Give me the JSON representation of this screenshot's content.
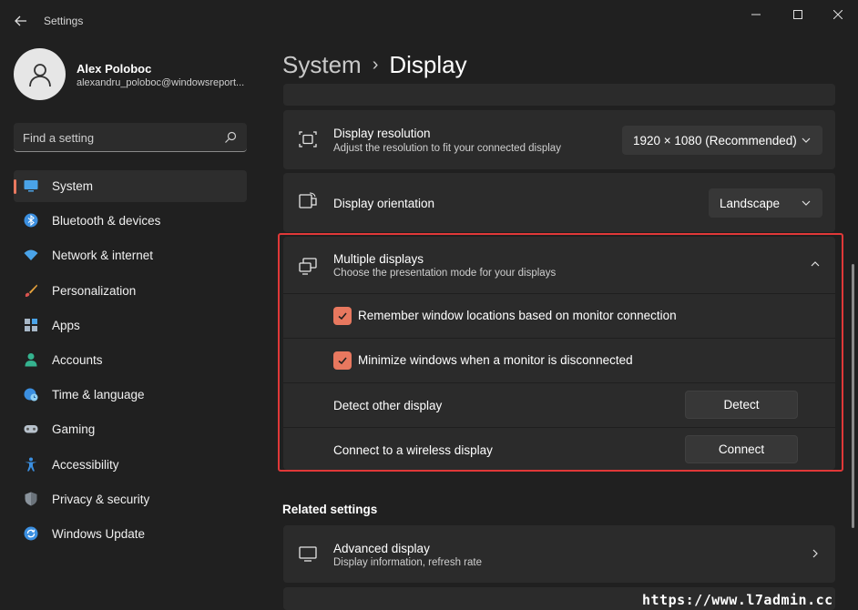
{
  "window": {
    "title": "Settings",
    "accent_color": "#e8785f",
    "highlight_color": "#e03838"
  },
  "profile": {
    "name": "Alex Poloboc",
    "email": "alexandru_poloboc@windowsreport..."
  },
  "search": {
    "placeholder": "Find a setting"
  },
  "nav": {
    "items": [
      {
        "label": "System",
        "icon": "system-icon",
        "active": true
      },
      {
        "label": "Bluetooth & devices",
        "icon": "bluetooth-icon"
      },
      {
        "label": "Network & internet",
        "icon": "wifi-icon"
      },
      {
        "label": "Personalization",
        "icon": "brush-icon"
      },
      {
        "label": "Apps",
        "icon": "apps-icon"
      },
      {
        "label": "Accounts",
        "icon": "person-icon"
      },
      {
        "label": "Time & language",
        "icon": "globe-clock-icon"
      },
      {
        "label": "Gaming",
        "icon": "gamepad-icon"
      },
      {
        "label": "Accessibility",
        "icon": "accessibility-icon"
      },
      {
        "label": "Privacy & security",
        "icon": "shield-icon"
      },
      {
        "label": "Windows Update",
        "icon": "update-icon"
      }
    ]
  },
  "breadcrumb": {
    "parent": "System",
    "separator": "›",
    "current": "Display"
  },
  "resolution": {
    "title": "Display resolution",
    "subtitle": "Adjust the resolution to fit your connected display",
    "value": "1920 × 1080 (Recommended)"
  },
  "orientation": {
    "title": "Display orientation",
    "value": "Landscape"
  },
  "multiple_displays": {
    "title": "Multiple displays",
    "subtitle": "Choose the presentation mode for your displays",
    "remember_label": "Remember window locations based on monitor connection",
    "remember_checked": true,
    "minimize_label": "Minimize windows when a monitor is disconnected",
    "minimize_checked": true,
    "detect_label": "Detect other display",
    "detect_button": "Detect",
    "connect_label": "Connect to a wireless display",
    "connect_button": "Connect"
  },
  "related": {
    "heading": "Related settings",
    "advanced_title": "Advanced display",
    "advanced_subtitle": "Display information, refresh rate"
  },
  "watermark": "https://www.l7admin.cc"
}
